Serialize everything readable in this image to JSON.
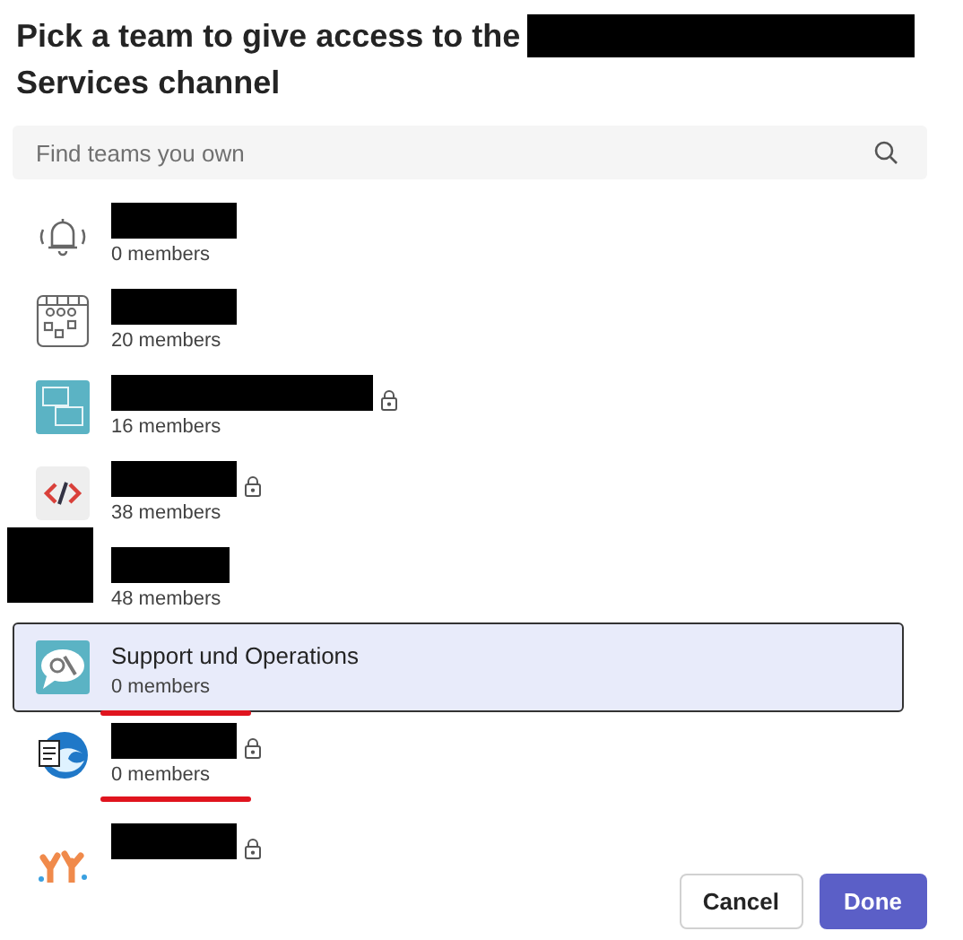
{
  "title": {
    "line_1": "Pick a team to give access to the",
    "line_2": "Services channel"
  },
  "search": {
    "placeholder": "Find teams you own"
  },
  "teams": [
    {
      "kind": "bell",
      "name_redacted": true,
      "members": "0 members",
      "locked": false,
      "selected": false,
      "underlined": false
    },
    {
      "kind": "board",
      "name_redacted": true,
      "members": "20 members",
      "locked": false,
      "selected": false,
      "underlined": false
    },
    {
      "kind": "code-chat",
      "name_redacted": true,
      "members": "16 members",
      "locked": true,
      "selected": false,
      "underlined": false
    },
    {
      "kind": "code",
      "name_redacted": true,
      "members": "38 members",
      "locked": true,
      "selected": false,
      "underlined": false
    },
    {
      "kind": "hidden",
      "name_redacted": true,
      "members": "48 members",
      "locked": false,
      "selected": false,
      "underlined": false
    },
    {
      "kind": "chat-gears",
      "name": "Support und Operations",
      "name_redacted": false,
      "members": "0 members",
      "locked": false,
      "selected": true,
      "underlined": true
    },
    {
      "kind": "wave",
      "name_redacted": true,
      "members": "0 members",
      "locked": true,
      "selected": false,
      "underlined": true
    },
    {
      "kind": "coral",
      "name_redacted": true,
      "locked": true,
      "selected": false,
      "underlined": false
    }
  ],
  "buttons": [
    {
      "label": "Cancel",
      "kind": "secondary"
    },
    {
      "label": "Done",
      "kind": "primary"
    }
  ]
}
